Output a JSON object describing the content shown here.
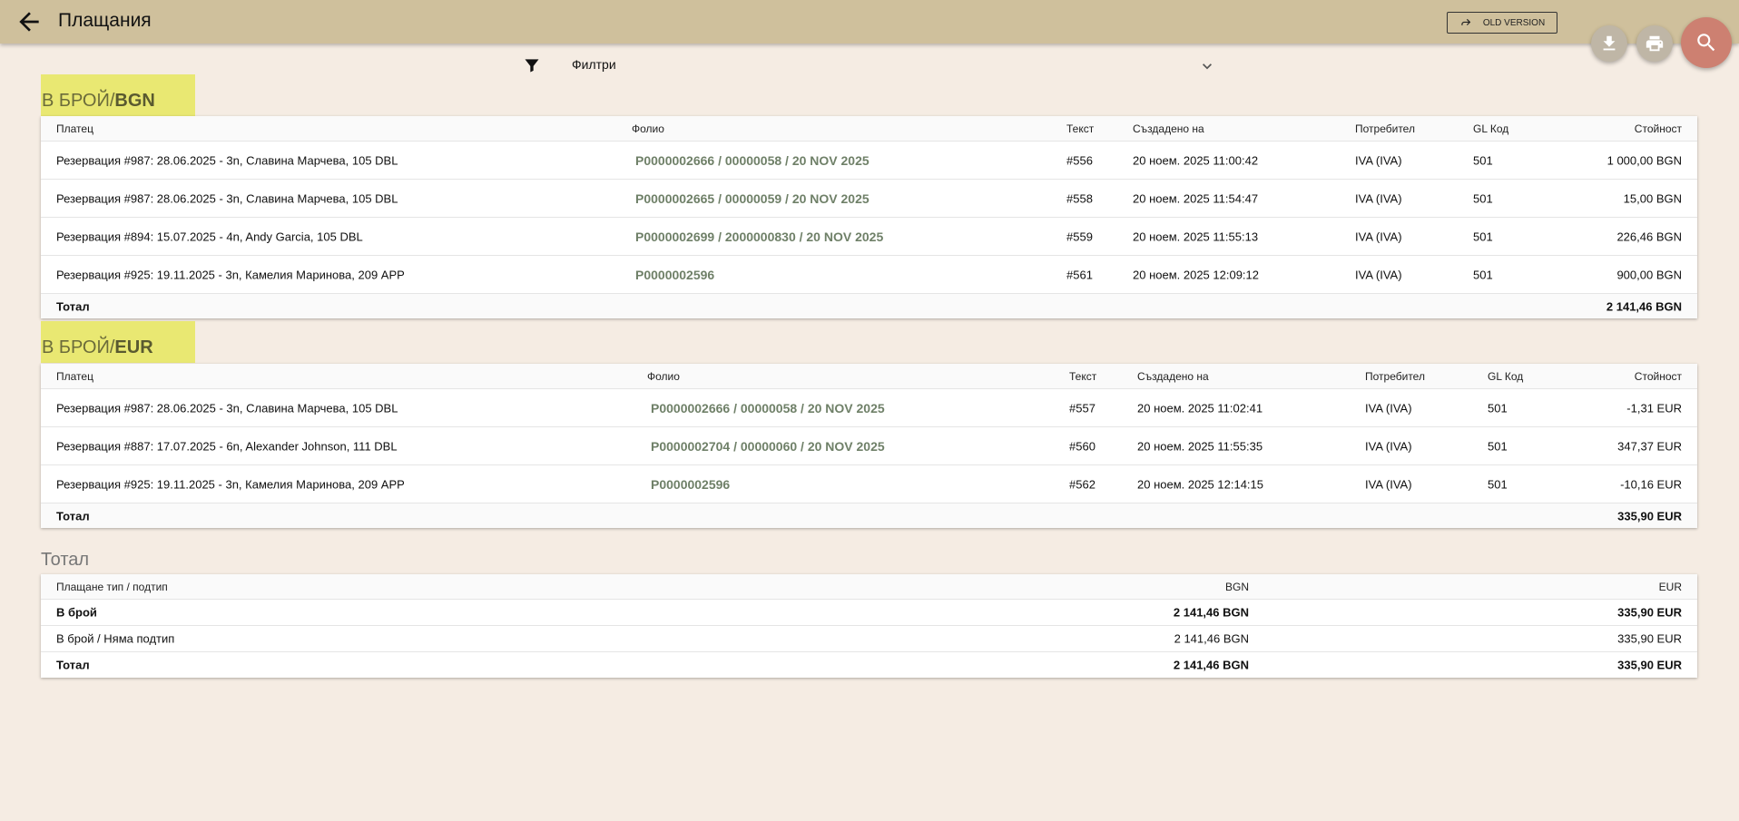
{
  "header": {
    "title": "Плащания",
    "old_version_label": "OLD VERSION"
  },
  "filter": {
    "label": "Филтри"
  },
  "columns": {
    "payer": "Платец",
    "folio": "Фолио",
    "text": "Текст",
    "created": "Създадено на",
    "user": "Потребител",
    "gl": "GL Код",
    "value": "Стойност"
  },
  "sections": [
    {
      "title_prefix": "В БРОЙ/",
      "title_currency": "BGN",
      "rows": [
        {
          "payer": "Резервация #987: 28.06.2025 - 3n, Славина Марчева, 105 DBL",
          "folio": "P0000002666 / 00000058 / 20 NOV 2025",
          "text": "#556",
          "created": "20 ноем. 2025 11:00:42",
          "user": "IVA (IVA)",
          "gl": "501",
          "value": "1 000,00 BGN"
        },
        {
          "payer": "Резервация #987: 28.06.2025 - 3n, Славина Марчева, 105 DBL",
          "folio": "P0000002665 / 00000059 / 20 NOV 2025",
          "text": "#558",
          "created": "20 ноем. 2025 11:54:47",
          "user": "IVA (IVA)",
          "gl": "501",
          "value": "15,00 BGN"
        },
        {
          "payer": "Резервация #894: 15.07.2025 - 4n, Andy Garcia, 105 DBL",
          "folio": "P0000002699 / 2000000830 / 20 NOV 2025",
          "text": "#559",
          "created": "20 ноем. 2025 11:55:13",
          "user": "IVA (IVA)",
          "gl": "501",
          "value": "226,46 BGN"
        },
        {
          "payer": "Резервация #925: 19.11.2025 - 3n, Камелия Маринова, 209 APP",
          "folio": "P0000002596",
          "text": "#561",
          "created": "20 ноем. 2025 12:09:12",
          "user": "IVA (IVA)",
          "gl": "501",
          "value": "900,00 BGN"
        }
      ],
      "total_label": "Тотал",
      "total_value": "2 141,46 BGN"
    },
    {
      "title_prefix": "В БРОЙ/",
      "title_currency": "EUR",
      "rows": [
        {
          "payer": "Резервация #987: 28.06.2025 - 3n, Славина Марчева, 105 DBL",
          "folio": "P0000002666 / 00000058 / 20 NOV 2025",
          "text": "#557",
          "created": "20 ноем. 2025 11:02:41",
          "user": "IVA (IVA)",
          "gl": "501",
          "value": "-1,31 EUR"
        },
        {
          "payer": "Резервация #887: 17.07.2025 - 6n, Alexander Johnson, 111 DBL",
          "folio": "P0000002704 / 00000060 / 20 NOV 2025",
          "text": "#560",
          "created": "20 ноем. 2025 11:55:35",
          "user": "IVA (IVA)",
          "gl": "501",
          "value": "347,37 EUR"
        },
        {
          "payer": "Резервация #925: 19.11.2025 - 3n, Камелия Маринова, 209 APP",
          "folio": "P0000002596",
          "text": "#562",
          "created": "20 ноем. 2025 12:14:15",
          "user": "IVA (IVA)",
          "gl": "501",
          "value": "-10,16 EUR"
        }
      ],
      "total_label": "Тотал",
      "total_value": "335,90 EUR"
    }
  ],
  "grand": {
    "title": "Тотал",
    "col_type": "Плащане тип / подтип",
    "col_bgn": "BGN",
    "col_eur": "EUR",
    "rows": [
      {
        "label": "В брой",
        "bgn": "2 141,46 BGN",
        "eur": "335,90 EUR",
        "bold": true
      },
      {
        "label": "В брой / Няма подтип",
        "bgn": "2 141,46 BGN",
        "eur": "335,90 EUR",
        "bold": false
      },
      {
        "label": "Тотал",
        "bgn": "2 141,46 BGN",
        "eur": "335,90 EUR",
        "bold": true
      }
    ]
  }
}
